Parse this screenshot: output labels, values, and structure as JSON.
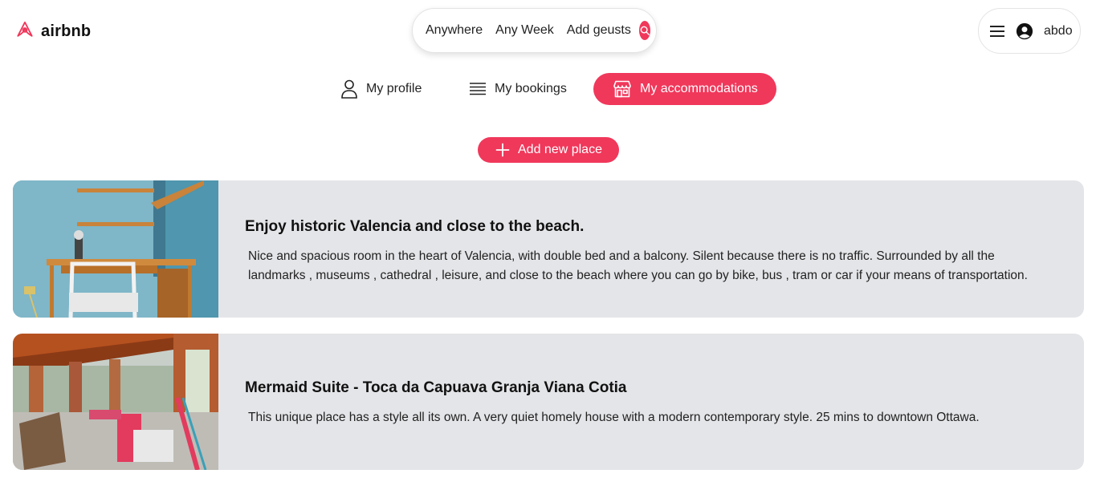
{
  "header": {
    "logo_text": "airbnb",
    "search": {
      "where": "Anywhere",
      "when": "Any Week",
      "guests": "Add geusts"
    },
    "user_name": "abdo"
  },
  "nav": {
    "profile": "My profile",
    "bookings": "My bookings",
    "accommodations": "My accommodations"
  },
  "add_button_label": "Add new place",
  "places": [
    {
      "title": "Enjoy historic Valencia and close to the beach.",
      "description": "Nice and spacious room in the heart of Valencia, with double bed and a balcony. Silent because there is no traffic. Surrounded by all the landmarks , museums , cathedral , leisure, and close to the beach where you can go by bike, bus , tram or car if your means of transportation."
    },
    {
      "title": "Mermaid Suite - Toca da Capuava Granja Viana Cotia",
      "description": "This unique place has a style all its own. A very quiet homely house with a modern contemporary style. 25 mins to downtown Ottawa."
    }
  ],
  "colors": {
    "accent": "#f0385b",
    "card_bg": "#e4e5e8"
  }
}
